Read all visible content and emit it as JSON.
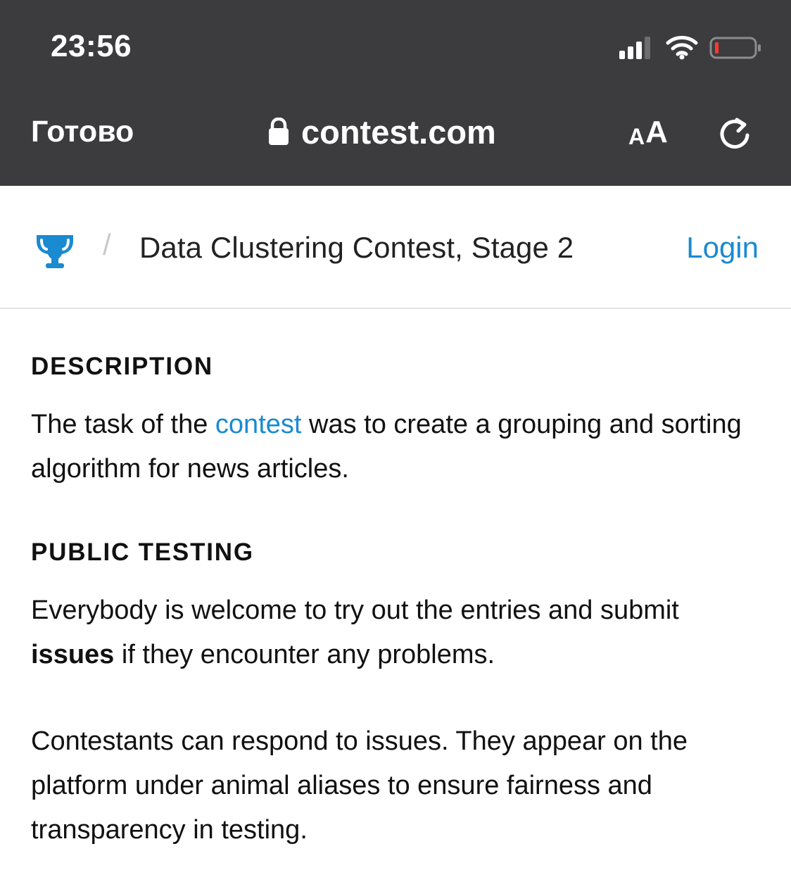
{
  "status_bar": {
    "time": "23:56"
  },
  "browser": {
    "done_label": "Готово",
    "url": "contest.com",
    "reader_label_small": "A",
    "reader_label_big": "A",
    "icons": {
      "lock": "lock-icon",
      "reload": "reload-icon",
      "signal": "signal-icon",
      "wifi": "wifi-icon",
      "battery": "battery-icon"
    }
  },
  "header": {
    "separator": "/",
    "title": "Data Clustering Contest, Stage 2",
    "login": "Login",
    "icon": "trophy-icon",
    "accent": "#1a8ad1"
  },
  "content": {
    "description": {
      "heading": "DESCRIPTION",
      "text_before": "The task of the ",
      "link_text": "contest",
      "text_after": " was to create a grouping and sorting algorithm for news articles."
    },
    "public_testing": {
      "heading": "PUBLIC TESTING",
      "p1_part1": "Everybody is welcome to try out the entries and submit ",
      "p1_bold": "issues",
      "p1_part2": " if they encounter any problems.",
      "p2": "Contestants can respond to issues. They appear on the platform under animal aliases to ensure fairness and transparency in testing."
    }
  }
}
